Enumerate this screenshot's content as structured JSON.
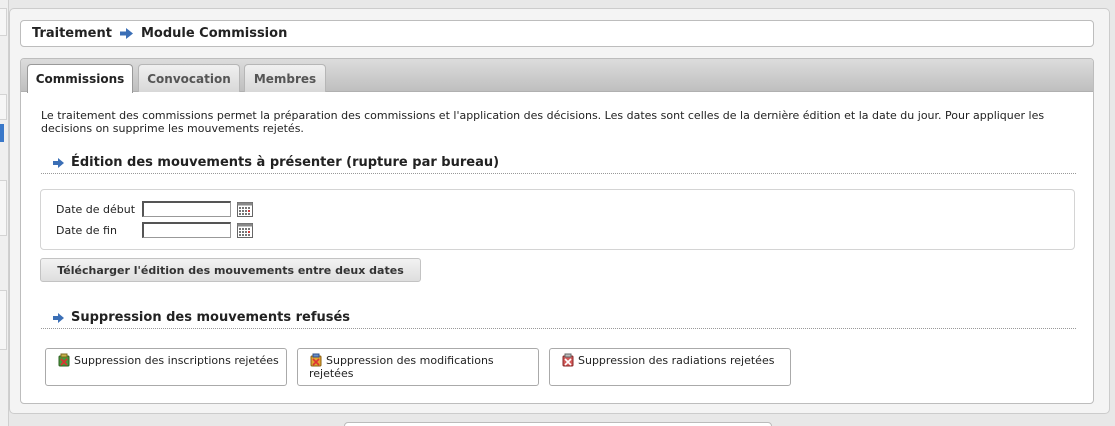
{
  "breadcrumb": {
    "part1": "Traitement",
    "part2": "Module Commission"
  },
  "tabs": [
    {
      "label": "Commissions",
      "active": true
    },
    {
      "label": "Convocation",
      "active": false
    },
    {
      "label": "Membres",
      "active": false
    }
  ],
  "description": "Le traitement des commissions permet la préparation des commissions et l'application des décisions. Les dates sont celles de la dernière édition et la date du jour. Pour appliquer les decisions on supprime les mouvements rejetés.",
  "section_edition": {
    "title": "Édition des mouvements à présenter (rupture par bureau)",
    "date_debut_label": "Date de début",
    "date_debut_value": "",
    "date_fin_label": "Date de fin",
    "date_fin_value": "",
    "download_button": "Télécharger l'édition des mouvements entre deux dates"
  },
  "section_suppression": {
    "title": "Suppression des mouvements refusés",
    "buttons": [
      {
        "label": "Suppression des inscriptions rejetées",
        "icon": "inscription-delete-icon"
      },
      {
        "label": "Suppression des modifications rejetées",
        "icon": "modification-delete-icon"
      },
      {
        "label": "Suppression des radiations rejetées",
        "icon": "radiation-delete-icon"
      }
    ]
  },
  "colors": {
    "accent_arrow": "#3b6fb6",
    "active_tab_bg": "#ffffff"
  }
}
